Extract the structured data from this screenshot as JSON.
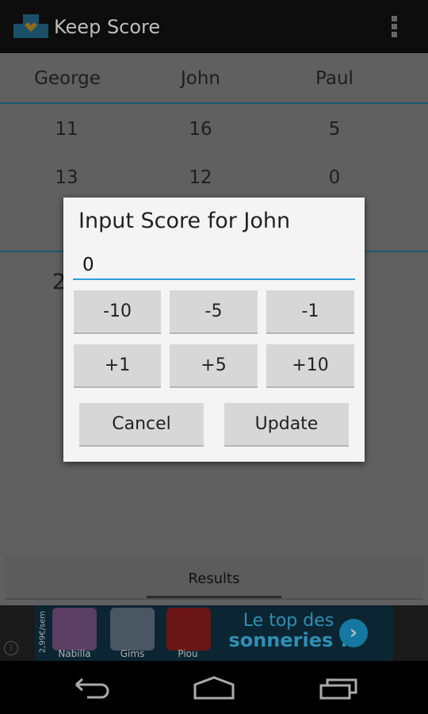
{
  "app": {
    "title": "Keep Score",
    "logo_icon": "podium-icon",
    "menu_icon": "overflow-menu-icon"
  },
  "table": {
    "players": [
      "George",
      "John",
      "Paul"
    ],
    "rounds": [
      [
        "11",
        "16",
        "5"
      ],
      [
        "13",
        "12",
        "0"
      ]
    ],
    "totals_visible": "2"
  },
  "tabs": [
    {
      "label": "Results",
      "selected": true
    }
  ],
  "ad": {
    "price": "2,99€/sem",
    "items": [
      "Nabilla",
      "Gims",
      "Piou"
    ],
    "headline1": "Le top des",
    "headline2": "sonneries !",
    "arrow": "›",
    "info": "i"
  },
  "dialog": {
    "title": "Input Score for John",
    "value": "0",
    "increments": [
      "-10",
      "-5",
      "-1",
      "+1",
      "+5",
      "+10"
    ],
    "cancel": "Cancel",
    "update": "Update"
  },
  "colors": {
    "accent": "#33b5e5",
    "actionbar": "#111111"
  }
}
